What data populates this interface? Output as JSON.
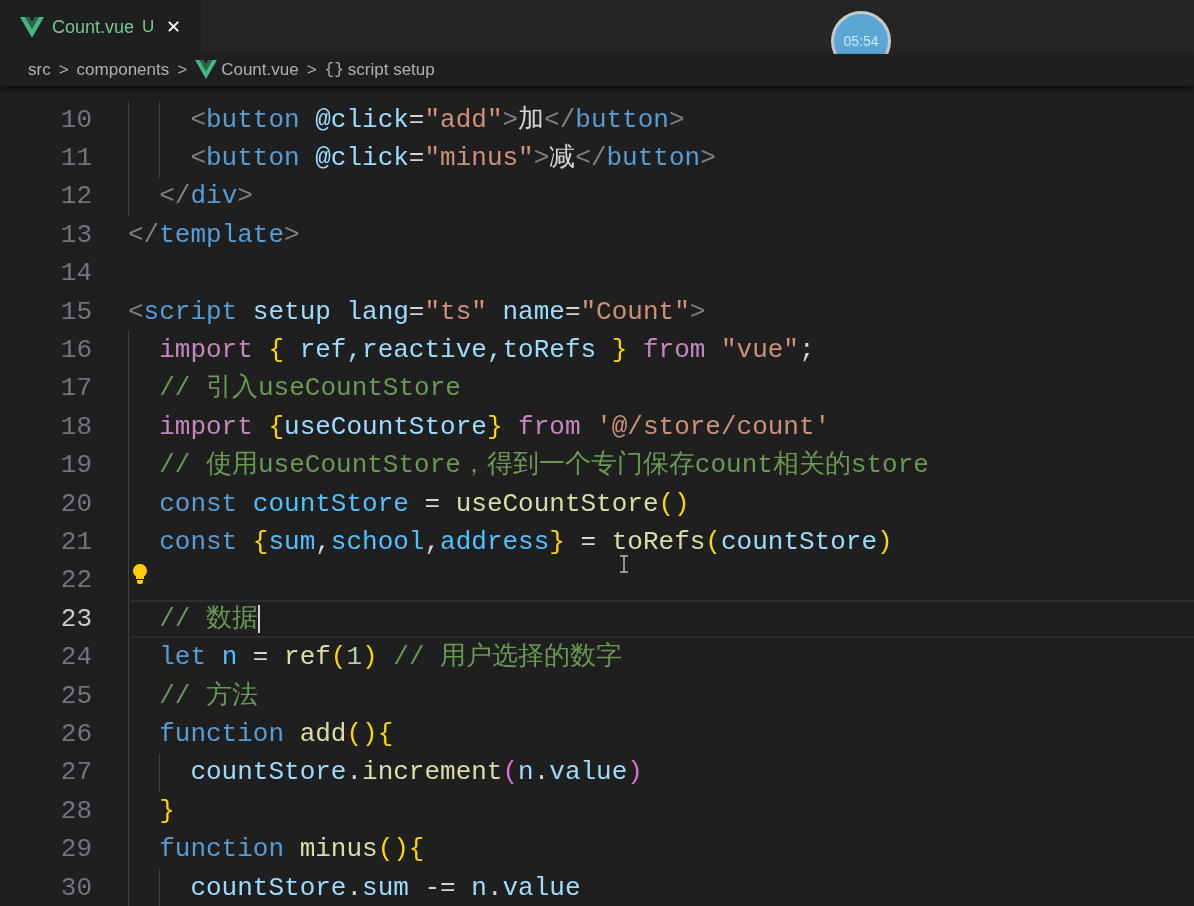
{
  "tab": {
    "label": "Count.vue",
    "badge": "U",
    "close": "✕",
    "selected": true
  },
  "breadcrumb": [
    {
      "kind": "text",
      "label": "src"
    },
    {
      "kind": "text",
      "label": "components"
    },
    {
      "kind": "vue",
      "label": "Count.vue"
    },
    {
      "kind": "braces",
      "icon": "{}",
      "label": "script setup"
    }
  ],
  "separator": ">",
  "timer": "05:54",
  "lines": [
    {
      "number": "10",
      "current": false,
      "lightbulb": false,
      "tokens": [
        {
          "kind": "punct",
          "text": "    <"
        },
        {
          "kind": "tag",
          "text": "button "
        },
        {
          "kind": "attr",
          "text": "@click"
        },
        {
          "kind": "plain",
          "text": "="
        },
        {
          "kind": "string",
          "text": "\"add\""
        },
        {
          "kind": "punct",
          "text": ">"
        },
        {
          "kind": "plain",
          "text": "加"
        },
        {
          "kind": "punct",
          "text": "</"
        },
        {
          "kind": "tag",
          "text": "button"
        },
        {
          "kind": "punct",
          "text": ">"
        }
      ]
    },
    {
      "number": "11",
      "current": false,
      "lightbulb": false,
      "tokens": [
        {
          "kind": "punct",
          "text": "    <"
        },
        {
          "kind": "tag",
          "text": "button "
        },
        {
          "kind": "attr",
          "text": "@click"
        },
        {
          "kind": "plain",
          "text": "="
        },
        {
          "kind": "string",
          "text": "\"minus\""
        },
        {
          "kind": "punct",
          "text": ">"
        },
        {
          "kind": "plain",
          "text": "减"
        },
        {
          "kind": "punct",
          "text": "</"
        },
        {
          "kind": "tag",
          "text": "button"
        },
        {
          "kind": "punct",
          "text": ">"
        }
      ]
    },
    {
      "number": "12",
      "current": false,
      "lightbulb": false,
      "tokens": [
        {
          "kind": "punct",
          "text": "  </"
        },
        {
          "kind": "tag",
          "text": "div"
        },
        {
          "kind": "punct",
          "text": ">"
        }
      ]
    },
    {
      "number": "13",
      "current": false,
      "lightbulb": false,
      "tokens": [
        {
          "kind": "punct",
          "text": "</"
        },
        {
          "kind": "tag",
          "text": "template"
        },
        {
          "kind": "punct",
          "text": ">"
        }
      ]
    },
    {
      "number": "14",
      "current": false,
      "lightbulb": false
    },
    {
      "number": "15",
      "current": false,
      "lightbulb": false,
      "tokens": [
        {
          "kind": "punct",
          "text": "<"
        },
        {
          "kind": "tag",
          "text": "script "
        },
        {
          "kind": "attr",
          "text": "setup lang"
        },
        {
          "kind": "plain",
          "text": "="
        },
        {
          "kind": "string",
          "text": "\"ts\" "
        },
        {
          "kind": "attr",
          "text": "name"
        },
        {
          "kind": "plain",
          "text": "="
        },
        {
          "kind": "string",
          "text": "\"Count\""
        },
        {
          "kind": "punct",
          "text": ">"
        }
      ]
    },
    {
      "number": "16",
      "current": false,
      "lightbulb": false,
      "tokens": [
        {
          "kind": "control",
          "text": "  import "
        },
        {
          "kind": "bracket1",
          "text": "{"
        },
        {
          "kind": "var",
          "text": " ref,reactive,toRefs "
        },
        {
          "kind": "bracket1",
          "text": "} "
        },
        {
          "kind": "control",
          "text": "from "
        },
        {
          "kind": "string",
          "text": "\"vue\""
        },
        {
          "kind": "plain",
          "text": ";"
        }
      ]
    },
    {
      "number": "17",
      "current": false,
      "lightbulb": false,
      "tokens": [
        {
          "kind": "comment",
          "text": "  // 引入useCountStore"
        }
      ]
    },
    {
      "number": "18",
      "current": false,
      "lightbulb": false,
      "tokens": [
        {
          "kind": "control",
          "text": "  import "
        },
        {
          "kind": "bracket1",
          "text": "{"
        },
        {
          "kind": "var",
          "text": "useCountStore"
        },
        {
          "kind": "bracket1",
          "text": "} "
        },
        {
          "kind": "control",
          "text": "from "
        },
        {
          "kind": "string",
          "text": "'@/store/count'"
        }
      ]
    },
    {
      "number": "19",
      "current": false,
      "lightbulb": false,
      "tokens": [
        {
          "kind": "comment",
          "text": "  // 使用useCountStore，得到一个专门保存count相关的store"
        }
      ]
    },
    {
      "number": "20",
      "current": false,
      "lightbulb": false,
      "tokens": [
        {
          "kind": "keyword",
          "text": "  const "
        },
        {
          "kind": "const",
          "text": "countStore"
        },
        {
          "kind": "plain",
          "text": " = "
        },
        {
          "kind": "func",
          "text": "useCountStore"
        },
        {
          "kind": "bracket1",
          "text": "()"
        }
      ]
    },
    {
      "number": "21",
      "current": false,
      "lightbulb": false,
      "tokens": [
        {
          "kind": "keyword",
          "text": "  const "
        },
        {
          "kind": "bracket1",
          "text": "{"
        },
        {
          "kind": "const",
          "text": "sum"
        },
        {
          "kind": "plain",
          "text": ","
        },
        {
          "kind": "const",
          "text": "school"
        },
        {
          "kind": "plain",
          "text": ","
        },
        {
          "kind": "const",
          "text": "address"
        },
        {
          "kind": "bracket1",
          "text": "}"
        },
        {
          "kind": "plain",
          "text": " = "
        },
        {
          "kind": "func",
          "text": "toRefs"
        },
        {
          "kind": "bracket1",
          "text": "("
        },
        {
          "kind": "var",
          "text": "countStore"
        },
        {
          "kind": "bracket1",
          "text": ")"
        }
      ]
    },
    {
      "number": "22",
      "current": false,
      "lightbulb": true
    },
    {
      "number": "23",
      "current": true,
      "lightbulb": false,
      "tokens": [
        {
          "kind": "comment",
          "text": "  // 数据"
        }
      ]
    },
    {
      "number": "24",
      "current": false,
      "lightbulb": false,
      "tokens": [
        {
          "kind": "keyword",
          "text": "  let "
        },
        {
          "kind": "const",
          "text": "n"
        },
        {
          "kind": "plain",
          "text": " = "
        },
        {
          "kind": "func",
          "text": "ref"
        },
        {
          "kind": "bracket1",
          "text": "("
        },
        {
          "kind": "number",
          "text": "1"
        },
        {
          "kind": "bracket1",
          "text": ") "
        },
        {
          "kind": "comment",
          "text": "// 用户选择的数字"
        }
      ]
    },
    {
      "number": "25",
      "current": false,
      "lightbulb": false,
      "tokens": [
        {
          "kind": "comment",
          "text": "  // 方法"
        }
      ]
    },
    {
      "number": "26",
      "current": false,
      "lightbulb": false,
      "tokens": [
        {
          "kind": "keyword",
          "text": "  function "
        },
        {
          "kind": "func",
          "text": "add"
        },
        {
          "kind": "bracket1",
          "text": "(){"
        }
      ]
    },
    {
      "number": "27",
      "current": false,
      "lightbulb": false,
      "tokens": [
        {
          "kind": "var",
          "text": "    countStore"
        },
        {
          "kind": "plain",
          "text": "."
        },
        {
          "kind": "func",
          "text": "increment"
        },
        {
          "kind": "bracket2",
          "text": "("
        },
        {
          "kind": "var",
          "text": "n"
        },
        {
          "kind": "plain",
          "text": "."
        },
        {
          "kind": "var",
          "text": "value"
        },
        {
          "kind": "bracket2",
          "text": ")"
        }
      ]
    },
    {
      "number": "28",
      "current": false,
      "lightbulb": false,
      "tokens": [
        {
          "kind": "bracket1",
          "text": "  }"
        }
      ]
    },
    {
      "number": "29",
      "current": false,
      "lightbulb": false,
      "tokens": [
        {
          "kind": "keyword",
          "text": "  function "
        },
        {
          "kind": "func",
          "text": "minus"
        },
        {
          "kind": "bracket1",
          "text": "(){"
        }
      ]
    },
    {
      "number": "30",
      "current": false,
      "lightbulb": false,
      "tokens": [
        {
          "kind": "var",
          "text": "    countStore"
        },
        {
          "kind": "plain",
          "text": "."
        },
        {
          "kind": "var",
          "text": "sum"
        },
        {
          "kind": "plain",
          "text": " -= "
        },
        {
          "kind": "var",
          "text": "n"
        },
        {
          "kind": "plain",
          "text": "."
        },
        {
          "kind": "var",
          "text": "value"
        }
      ]
    }
  ]
}
